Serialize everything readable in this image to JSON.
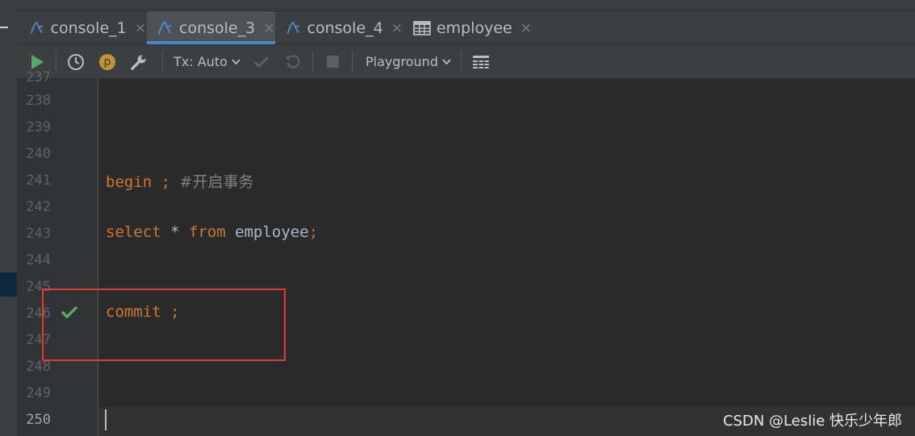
{
  "tabs": [
    {
      "label": "console_1",
      "icon": "mysql-console-icon",
      "active": false
    },
    {
      "label": "console_3",
      "icon": "mysql-console-icon",
      "active": true
    },
    {
      "label": "console_4",
      "icon": "mysql-console-icon",
      "active": false
    },
    {
      "label": "employee",
      "icon": "table-grid-icon",
      "active": false
    }
  ],
  "tab_close_glyph": "×",
  "toolbar": {
    "tx_label": "Tx: Auto",
    "p_label": "p",
    "playground_label": "Playground"
  },
  "editor": {
    "partial_line_number": "237",
    "lines": [
      {
        "number": "238"
      },
      {
        "number": "239"
      },
      {
        "number": "240"
      },
      {
        "number": "241",
        "tokens": [
          {
            "t": "begin ;",
            "c": "kw"
          },
          {
            "t": " ",
            "c": "plain"
          },
          {
            "t": "#开启事务",
            "c": "cm"
          }
        ]
      },
      {
        "number": "242"
      },
      {
        "number": "243",
        "tokens": [
          {
            "t": "select",
            "c": "kw"
          },
          {
            "t": " * ",
            "c": "plain"
          },
          {
            "t": "from",
            "c": "kw"
          },
          {
            "t": " employee",
            "c": "plain"
          },
          {
            "t": ";",
            "c": "kw"
          }
        ]
      },
      {
        "number": "244"
      },
      {
        "number": "245"
      },
      {
        "number": "246",
        "tokens": [
          {
            "t": "commit ;",
            "c": "kw"
          }
        ],
        "executed": true
      },
      {
        "number": "247"
      },
      {
        "number": "248"
      },
      {
        "number": "249"
      },
      {
        "number": "250",
        "current": true
      }
    ]
  },
  "watermark": "CSDN @Leslie 快乐少年郎",
  "colors": {
    "keyword": "#cc7832",
    "identifier": "#a9b7c6",
    "comment": "#808080",
    "highlight_box": "#e03b3b",
    "run_green": "#59a869",
    "active_tab_underline": "#4a88c7"
  }
}
